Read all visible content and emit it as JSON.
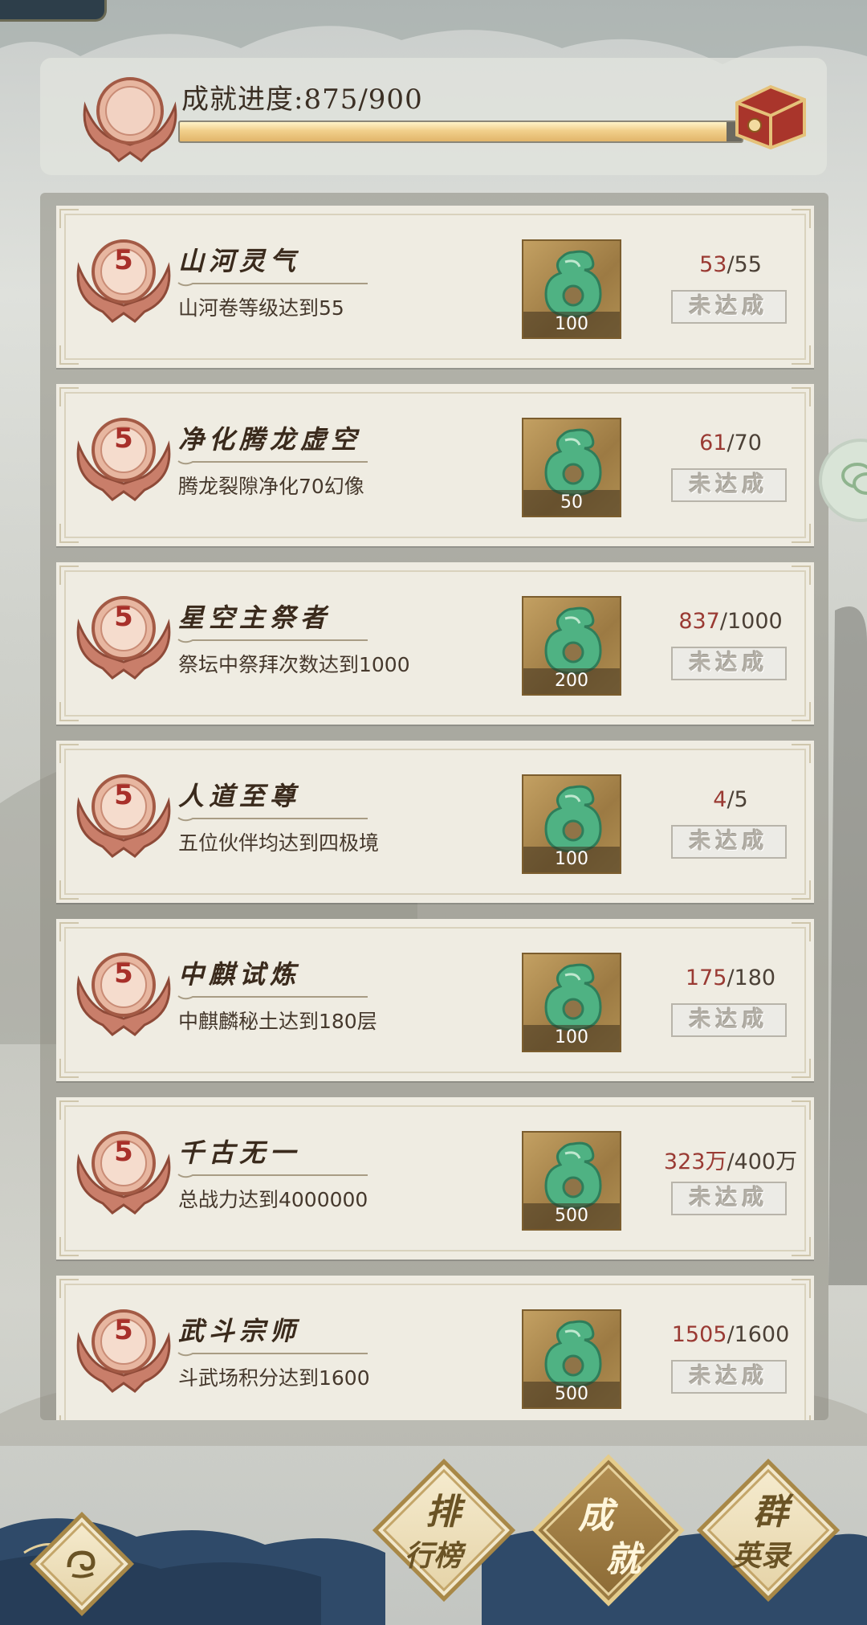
{
  "header": {
    "progress_label": "成就进度:875/900",
    "progress_fraction": 0.9722
  },
  "achievements": [
    {
      "level": "5",
      "name": "山河灵气",
      "desc": "山河卷等级达到55",
      "reward_qty": "100",
      "current": "53",
      "target": "/55",
      "status": "未达成"
    },
    {
      "level": "5",
      "name": "净化腾龙虚空",
      "desc": "腾龙裂隙净化70幻像",
      "reward_qty": "50",
      "current": "61",
      "target": "/70",
      "status": "未达成"
    },
    {
      "level": "5",
      "name": "星空主祭者",
      "desc": "祭坛中祭拜次数达到1000",
      "reward_qty": "200",
      "current": "837",
      "target": "/1000",
      "status": "未达成"
    },
    {
      "level": "5",
      "name": "人道至尊",
      "desc": "五位伙伴均达到四极境",
      "reward_qty": "100",
      "current": "4",
      "target": "/5",
      "status": "未达成"
    },
    {
      "level": "5",
      "name": "中麒试炼",
      "desc": "中麒麟秘土达到180层",
      "reward_qty": "100",
      "current": "175",
      "target": "/180",
      "status": "未达成"
    },
    {
      "level": "5",
      "name": "千古无一",
      "desc": "总战力达到4000000",
      "reward_qty": "500",
      "current": "323万",
      "target": "/400万",
      "status": "未达成"
    },
    {
      "level": "5",
      "name": "武斗宗师",
      "desc": "斗武场积分达到1600",
      "reward_qty": "500",
      "current": "1505",
      "target": "/1600",
      "status": "未达成"
    }
  ],
  "nav": {
    "back_icon": "cloud-swirl-icon",
    "ranking": {
      "c1": "排",
      "c2": "行榜"
    },
    "achievement": {
      "c1": "成",
      "c2": "就"
    },
    "heroes": {
      "c1": "群",
      "c2": "英录"
    }
  },
  "icons": {
    "reward": "jade-dragon-pendant-icon",
    "chat": "wechat-icon",
    "chest": "treasure-chest-icon"
  },
  "colors": {
    "current_value": "#9a3a33",
    "progress_fill": "#f1cf8b"
  }
}
